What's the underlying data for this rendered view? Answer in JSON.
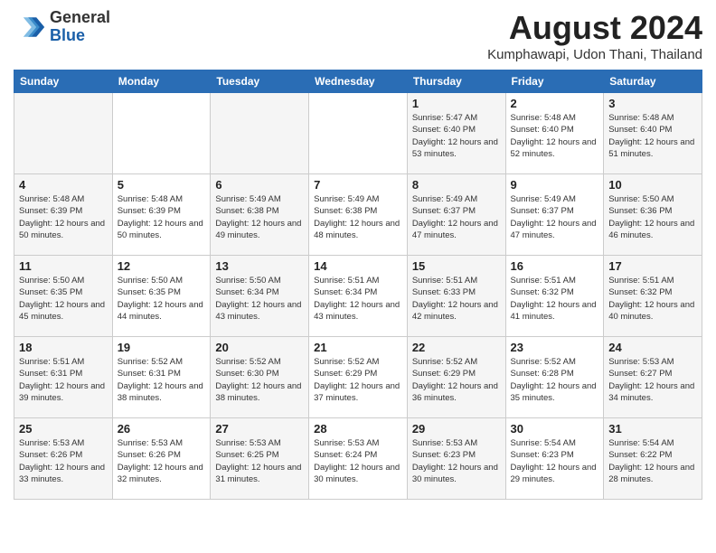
{
  "header": {
    "logo_general": "General",
    "logo_blue": "Blue",
    "month_title": "August 2024",
    "location": "Kumphawapi, Udon Thani, Thailand"
  },
  "days_of_week": [
    "Sunday",
    "Monday",
    "Tuesday",
    "Wednesday",
    "Thursday",
    "Friday",
    "Saturday"
  ],
  "weeks": [
    [
      {
        "day": "",
        "info": ""
      },
      {
        "day": "",
        "info": ""
      },
      {
        "day": "",
        "info": ""
      },
      {
        "day": "",
        "info": ""
      },
      {
        "day": "1",
        "info": "Sunrise: 5:47 AM\nSunset: 6:40 PM\nDaylight: 12 hours\nand 53 minutes."
      },
      {
        "day": "2",
        "info": "Sunrise: 5:48 AM\nSunset: 6:40 PM\nDaylight: 12 hours\nand 52 minutes."
      },
      {
        "day": "3",
        "info": "Sunrise: 5:48 AM\nSunset: 6:40 PM\nDaylight: 12 hours\nand 51 minutes."
      }
    ],
    [
      {
        "day": "4",
        "info": "Sunrise: 5:48 AM\nSunset: 6:39 PM\nDaylight: 12 hours\nand 50 minutes."
      },
      {
        "day": "5",
        "info": "Sunrise: 5:48 AM\nSunset: 6:39 PM\nDaylight: 12 hours\nand 50 minutes."
      },
      {
        "day": "6",
        "info": "Sunrise: 5:49 AM\nSunset: 6:38 PM\nDaylight: 12 hours\nand 49 minutes."
      },
      {
        "day": "7",
        "info": "Sunrise: 5:49 AM\nSunset: 6:38 PM\nDaylight: 12 hours\nand 48 minutes."
      },
      {
        "day": "8",
        "info": "Sunrise: 5:49 AM\nSunset: 6:37 PM\nDaylight: 12 hours\nand 47 minutes."
      },
      {
        "day": "9",
        "info": "Sunrise: 5:49 AM\nSunset: 6:37 PM\nDaylight: 12 hours\nand 47 minutes."
      },
      {
        "day": "10",
        "info": "Sunrise: 5:50 AM\nSunset: 6:36 PM\nDaylight: 12 hours\nand 46 minutes."
      }
    ],
    [
      {
        "day": "11",
        "info": "Sunrise: 5:50 AM\nSunset: 6:35 PM\nDaylight: 12 hours\nand 45 minutes."
      },
      {
        "day": "12",
        "info": "Sunrise: 5:50 AM\nSunset: 6:35 PM\nDaylight: 12 hours\nand 44 minutes."
      },
      {
        "day": "13",
        "info": "Sunrise: 5:50 AM\nSunset: 6:34 PM\nDaylight: 12 hours\nand 43 minutes."
      },
      {
        "day": "14",
        "info": "Sunrise: 5:51 AM\nSunset: 6:34 PM\nDaylight: 12 hours\nand 43 minutes."
      },
      {
        "day": "15",
        "info": "Sunrise: 5:51 AM\nSunset: 6:33 PM\nDaylight: 12 hours\nand 42 minutes."
      },
      {
        "day": "16",
        "info": "Sunrise: 5:51 AM\nSunset: 6:32 PM\nDaylight: 12 hours\nand 41 minutes."
      },
      {
        "day": "17",
        "info": "Sunrise: 5:51 AM\nSunset: 6:32 PM\nDaylight: 12 hours\nand 40 minutes."
      }
    ],
    [
      {
        "day": "18",
        "info": "Sunrise: 5:51 AM\nSunset: 6:31 PM\nDaylight: 12 hours\nand 39 minutes."
      },
      {
        "day": "19",
        "info": "Sunrise: 5:52 AM\nSunset: 6:31 PM\nDaylight: 12 hours\nand 38 minutes."
      },
      {
        "day": "20",
        "info": "Sunrise: 5:52 AM\nSunset: 6:30 PM\nDaylight: 12 hours\nand 38 minutes."
      },
      {
        "day": "21",
        "info": "Sunrise: 5:52 AM\nSunset: 6:29 PM\nDaylight: 12 hours\nand 37 minutes."
      },
      {
        "day": "22",
        "info": "Sunrise: 5:52 AM\nSunset: 6:29 PM\nDaylight: 12 hours\nand 36 minutes."
      },
      {
        "day": "23",
        "info": "Sunrise: 5:52 AM\nSunset: 6:28 PM\nDaylight: 12 hours\nand 35 minutes."
      },
      {
        "day": "24",
        "info": "Sunrise: 5:53 AM\nSunset: 6:27 PM\nDaylight: 12 hours\nand 34 minutes."
      }
    ],
    [
      {
        "day": "25",
        "info": "Sunrise: 5:53 AM\nSunset: 6:26 PM\nDaylight: 12 hours\nand 33 minutes."
      },
      {
        "day": "26",
        "info": "Sunrise: 5:53 AM\nSunset: 6:26 PM\nDaylight: 12 hours\nand 32 minutes."
      },
      {
        "day": "27",
        "info": "Sunrise: 5:53 AM\nSunset: 6:25 PM\nDaylight: 12 hours\nand 31 minutes."
      },
      {
        "day": "28",
        "info": "Sunrise: 5:53 AM\nSunset: 6:24 PM\nDaylight: 12 hours\nand 30 minutes."
      },
      {
        "day": "29",
        "info": "Sunrise: 5:53 AM\nSunset: 6:23 PM\nDaylight: 12 hours\nand 30 minutes."
      },
      {
        "day": "30",
        "info": "Sunrise: 5:54 AM\nSunset: 6:23 PM\nDaylight: 12 hours\nand 29 minutes."
      },
      {
        "day": "31",
        "info": "Sunrise: 5:54 AM\nSunset: 6:22 PM\nDaylight: 12 hours\nand 28 minutes."
      }
    ]
  ]
}
